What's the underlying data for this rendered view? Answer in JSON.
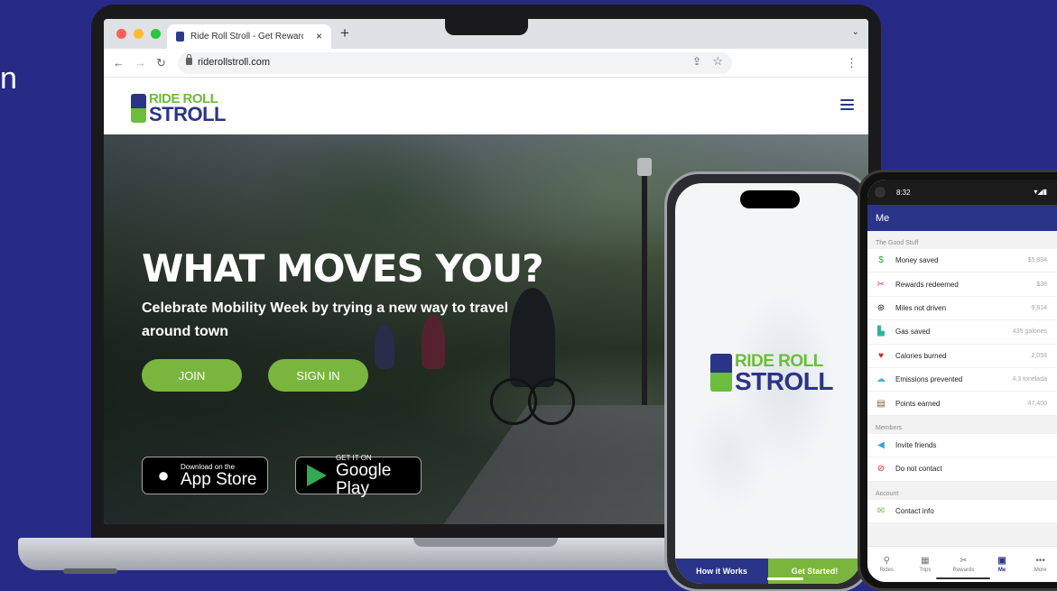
{
  "background": {
    "edge_letter": "n"
  },
  "browser": {
    "tab_title": "Ride Roll Stroll - Get Rewards",
    "tab_close": "×",
    "new_tab": "+",
    "tab_menu": "⌄",
    "url": "riderollstroll.com"
  },
  "site": {
    "logo_line1": "RIDE ROLL",
    "logo_line2": "STROLL",
    "hero_title": "WHAT MOVES YOU?",
    "hero_subtitle": "Celebrate Mobility Week by trying a new way to travel around town",
    "join_label": "JOIN",
    "signin_label": "SIGN IN",
    "appstore_small": "Download on the",
    "appstore_big": "App Store",
    "googleplay_small": "GET IT ON",
    "googleplay_big": "Google Play"
  },
  "iphone": {
    "logo_line1": "RIDE ROLL",
    "logo_line2": "STROLL",
    "how_it_works": "How it Works",
    "get_started": "Get Started!"
  },
  "android": {
    "time": "8:32",
    "status_icons": "▾◢▮",
    "header": "Me",
    "good_stuff_title": "The Good Stuff",
    "good_stuff": [
      {
        "icon": "dollar-icon",
        "glyph": "$",
        "color": "#3aa43a",
        "label": "Money saved",
        "value": "$5,884"
      },
      {
        "icon": "scissors-icon",
        "glyph": "✂",
        "color": "#d13b8a",
        "label": "Rewards redeemed",
        "value": "$38"
      },
      {
        "icon": "steering-wheel-icon",
        "glyph": "⊛",
        "color": "#222222",
        "label": "Miles not driven",
        "value": "9,814"
      },
      {
        "icon": "gas-pump-icon",
        "glyph": "▙",
        "color": "#2bb3a0",
        "label": "Gas saved",
        "value": "435 galones"
      },
      {
        "icon": "heart-icon",
        "glyph": "♥",
        "color": "#e02424",
        "label": "Calories burned",
        "value": "2,058"
      },
      {
        "icon": "cloud-icon",
        "glyph": "☁",
        "color": "#4ab0e0",
        "label": "Emissions prevented",
        "value": "4.3 tonelada"
      },
      {
        "icon": "points-icon",
        "glyph": "▤",
        "color": "#8b5a2b",
        "label": "Points earned",
        "value": "47,400"
      }
    ],
    "members_title": "Members",
    "members": [
      {
        "icon": "megaphone-icon",
        "glyph": "◀",
        "color": "#3aa0d8",
        "label": "Invite friends"
      },
      {
        "icon": "block-icon",
        "glyph": "⊘",
        "color": "#e02424",
        "label": "Do not contact"
      }
    ],
    "account_title": "Account",
    "account": [
      {
        "icon": "envelope-icon",
        "glyph": "✉",
        "color": "#7ab63d",
        "label": "Contact info"
      }
    ],
    "nav": [
      {
        "icon": "search-icon",
        "glyph": "⚲",
        "label": "Rides",
        "active": false
      },
      {
        "icon": "calendar-icon",
        "glyph": "▦",
        "label": "Trips",
        "active": false
      },
      {
        "icon": "scissors-icon",
        "glyph": "✂",
        "label": "Rewards",
        "active": false
      },
      {
        "icon": "profile-card-icon",
        "glyph": "▣",
        "label": "Me",
        "active": true
      },
      {
        "icon": "more-icon",
        "glyph": "•••",
        "label": "More",
        "active": false
      }
    ]
  }
}
